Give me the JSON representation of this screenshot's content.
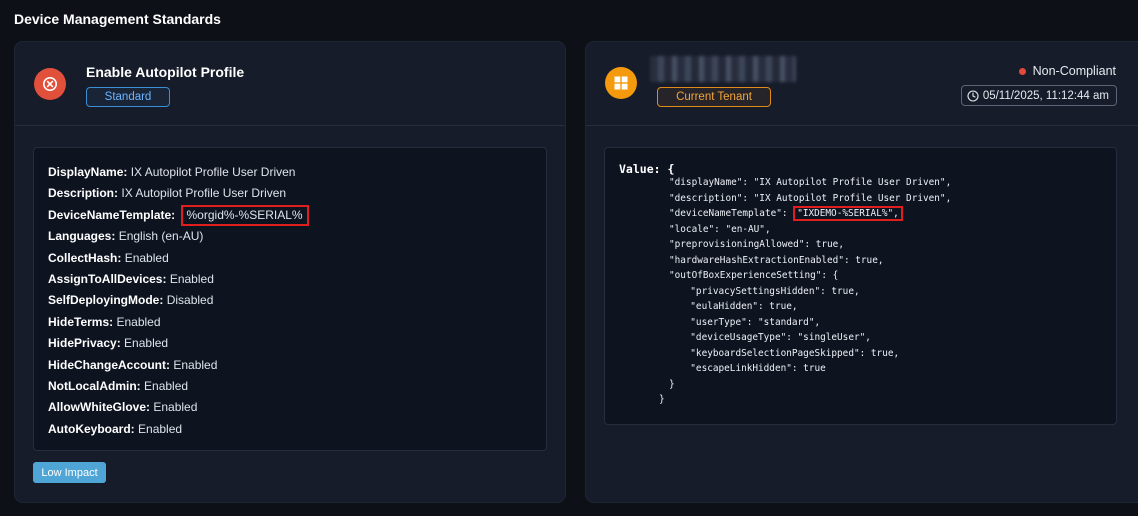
{
  "page": {
    "title": "Device Management Standards"
  },
  "standard": {
    "title": "Enable Autopilot Profile",
    "badge": "Standard",
    "impact": "Low Impact",
    "settings": [
      {
        "key": "DisplayName:",
        "value": "IX Autopilot Profile User Driven"
      },
      {
        "key": "Description:",
        "value": "IX Autopilot Profile User Driven"
      },
      {
        "key": "DeviceNameTemplate:",
        "value": "%orgid%-%SERIAL%",
        "highlighted": true
      },
      {
        "key": "Languages:",
        "value": "English (en-AU)"
      },
      {
        "key": "CollectHash:",
        "value": "Enabled"
      },
      {
        "key": "AssignToAllDevices:",
        "value": "Enabled"
      },
      {
        "key": "SelfDeployingMode:",
        "value": "Disabled"
      },
      {
        "key": "HideTerms:",
        "value": "Enabled"
      },
      {
        "key": "HidePrivacy:",
        "value": "Enabled"
      },
      {
        "key": "HideChangeAccount:",
        "value": "Enabled"
      },
      {
        "key": "NotLocalAdmin:",
        "value": "Enabled"
      },
      {
        "key": "AllowWhiteGlove:",
        "value": "Enabled"
      },
      {
        "key": "AutoKeyboard:",
        "value": "Enabled"
      }
    ]
  },
  "tenant": {
    "badge": "Current Tenant",
    "status": "Non-Compliant",
    "timestamp": "05/11/2025, 11:12:44 am",
    "value_label": "Value: {",
    "code_lines": [
      {
        "text": "\"displayName\": \"IX Autopilot Profile User Driven\","
      },
      {
        "text": "\"description\": \"IX Autopilot Profile User Driven\","
      },
      {
        "pre": "\"deviceNameTemplate\": ",
        "hl": "\"IXDEMO-%SERIAL%\","
      },
      {
        "text": "\"locale\": \"en-AU\","
      },
      {
        "text": "\"preprovisioningAllowed\": true,"
      },
      {
        "text": "\"hardwareHashExtractionEnabled\": true,"
      },
      {
        "text": "\"outOfBoxExperienceSetting\": {"
      },
      {
        "text": "  \"privacySettingsHidden\": true,"
      },
      {
        "text": "  \"eulaHidden\": true,"
      },
      {
        "text": "  \"userType\": \"standard\","
      },
      {
        "text": "  \"deviceUsageType\": \"singleUser\","
      },
      {
        "text": "  \"keyboardSelectionPageSkipped\": true,"
      },
      {
        "text": "  \"escapeLinkHidden\": true"
      },
      {
        "text": "}"
      },
      {
        "text": "}"
      }
    ],
    "code_indent": [
      0,
      0,
      0,
      0,
      0,
      0,
      0,
      0,
      0,
      0,
      0,
      0,
      0,
      0,
      -1
    ]
  },
  "colors": {
    "background": "#0d1117",
    "card": "#161c2a",
    "non_compliant": "#e24b3a",
    "standard_badge": "#3a8fd6",
    "tenant_badge": "#e08a1a",
    "highlight_border": "#e01e1e",
    "impact_badge": "#4fa6d6"
  },
  "icons": {
    "standard_status": "x-circle-icon",
    "tenant": "windows-logo-icon",
    "timestamp": "clock-icon"
  }
}
